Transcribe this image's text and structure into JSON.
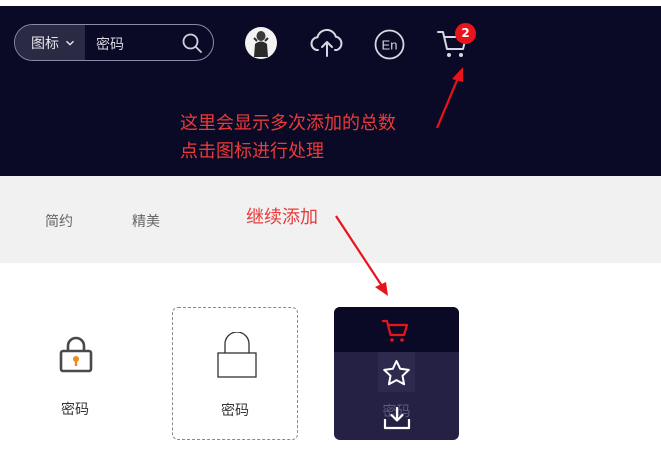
{
  "header": {
    "search": {
      "type_label": "图标",
      "value": "密码"
    },
    "icons": [
      "avatar",
      "upload-icon",
      "language-icon",
      "cart-icon"
    ],
    "lang_label": "En",
    "cart_count": "2"
  },
  "annotations": {
    "note_line1": "这里会显示多次添加的总数",
    "note_line2": "点击图标进行处理",
    "note_continue": "继续添加"
  },
  "tabs": {
    "items": [
      {
        "label": "简约"
      },
      {
        "label": "精美"
      }
    ]
  },
  "cards": [
    {
      "label": "密码",
      "icon": "lock-icon"
    },
    {
      "label": "密码",
      "icon": "lock-outline-icon"
    },
    {
      "label": "密码",
      "hover_actions": [
        "cart-icon",
        "star-icon",
        "download-icon"
      ]
    }
  ],
  "colors": {
    "header_bg": "#0b0a26",
    "annotation": "#ea3a3a",
    "badge": "#e8141b",
    "hover_card": "#242144",
    "lock_accent": "#f08c1c"
  }
}
